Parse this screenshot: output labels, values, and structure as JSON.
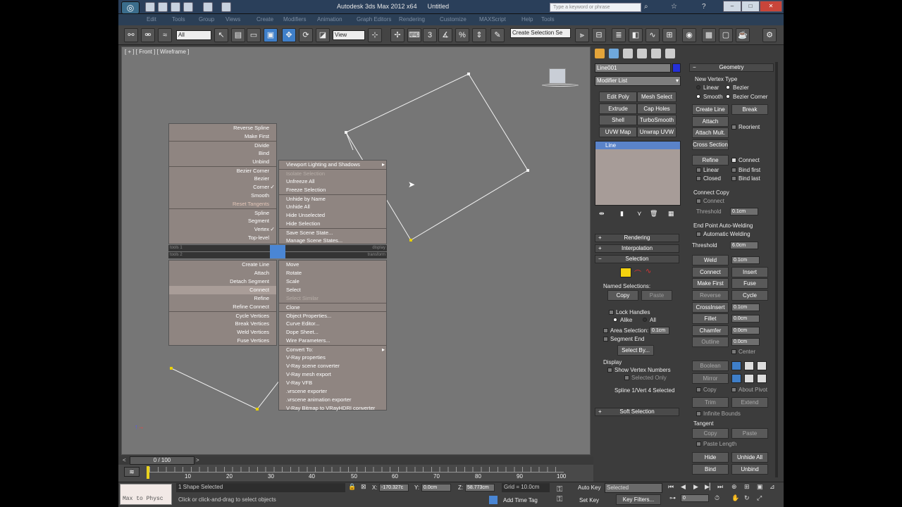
{
  "title": {
    "app": "Autodesk 3ds Max  2012 x64",
    "doc": "Untitled",
    "search_placeholder": "Type a keyword or phrase"
  },
  "menu": [
    "Edit",
    "Tools",
    "Group",
    "Views",
    "Create",
    "Modifiers",
    "Animation",
    "Graph Editors",
    "Rendering",
    "Customize",
    "MAXScript",
    "Help",
    "Tools"
  ],
  "toolbar": {
    "selection_filter": "All",
    "coord_system": "View",
    "named_set": "Create Selection Se",
    "snap_label": "3"
  },
  "viewport": {
    "label": "[ + ] [ Front ] [ Wireframe ]"
  },
  "quad": {
    "tl": [
      {
        "t": "Reverse Spline"
      },
      {
        "t": "Make First"
      },
      {
        "t": "Divide",
        "s": 1
      },
      {
        "t": "Bind"
      },
      {
        "t": "Unbind"
      },
      {
        "t": "Bezier Corner",
        "s": 1
      },
      {
        "t": "Bezier"
      },
      {
        "t": "Corner",
        "c": 1
      },
      {
        "t": "Smooth"
      },
      {
        "t": "Reset Tangents",
        "d": 1
      },
      {
        "t": "Spline",
        "s": 1
      },
      {
        "t": "Segment"
      },
      {
        "t": "Vertex",
        "c": 1
      },
      {
        "t": "Top-level"
      }
    ],
    "tr": [
      {
        "t": "Viewport Lighting and Shadows",
        "a": 1
      },
      {
        "t": "Isolate Selection",
        "s": 1,
        "g": 1
      },
      {
        "t": "Unfreeze All"
      },
      {
        "t": "Freeze Selection"
      },
      {
        "t": "Unhide by Name",
        "s": 1
      },
      {
        "t": "Unhide All"
      },
      {
        "t": "Hide Unselected"
      },
      {
        "t": "Hide Selection"
      },
      {
        "t": "Save Scene State...",
        "s": 1
      },
      {
        "t": "Manage Scene States..."
      }
    ],
    "bl": [
      {
        "t": "Create Line"
      },
      {
        "t": "Attach"
      },
      {
        "t": "Detach Segment"
      },
      {
        "t": "Connect",
        "h": 1
      },
      {
        "t": "Refine"
      },
      {
        "t": "Refine Connect"
      },
      {
        "t": "Cycle Vertices",
        "s": 1
      },
      {
        "t": "Break Vertices"
      },
      {
        "t": "Weld Vertices"
      },
      {
        "t": "Fuse Vertices"
      }
    ],
    "br": [
      {
        "t": "Move"
      },
      {
        "t": "Rotate"
      },
      {
        "t": "Scale"
      },
      {
        "t": "Select"
      },
      {
        "t": "Select Similar",
        "g": 1
      },
      {
        "t": "Clone",
        "s": 1
      },
      {
        "t": "Object Properties...",
        "s": 1
      },
      {
        "t": "Curve Editor..."
      },
      {
        "t": "Dope Sheet..."
      },
      {
        "t": "Wire Parameters..."
      },
      {
        "t": "Convert To:",
        "s": 1,
        "a": 1
      },
      {
        "t": "V-Ray properties"
      },
      {
        "t": "V-Ray scene converter"
      },
      {
        "t": "V-Ray mesh export"
      },
      {
        "t": "V-Ray VFB"
      },
      {
        "t": ".vrscene exporter"
      },
      {
        "t": ".vrscene animation exporter"
      },
      {
        "t": "V-Ray Bitmap to VRayHDRI converter"
      }
    ],
    "bar_left1": "tools 1",
    "bar_right1": "display",
    "bar_left2": "tools 2",
    "bar_right2": "transform"
  },
  "cmd": {
    "object_name": "Line001",
    "modifier_list": "Modifier List",
    "mod_buttons": [
      "Edit Poly",
      "Mesh Select",
      "Extrude",
      "Cap Holes",
      "Shell",
      "TurboSmooth",
      "UVW Map",
      "Unwrap UVW"
    ],
    "stack_item": "Line",
    "rollouts": {
      "rendering": "Rendering",
      "interpolation": "Interpolation",
      "selection": "Selection",
      "soft": "Soft Selection"
    },
    "selection": {
      "named": "Named Selections:",
      "copy": "Copy",
      "paste": "Paste",
      "lock": "Lock Handles",
      "alike": "Alike",
      "all": "All",
      "area": "Area Selection:",
      "area_val": "0.1cm",
      "seg_end": "Segment End",
      "select_by": "Select By...",
      "display": "Display",
      "show_vn": "Show Vertex Numbers",
      "sel_only": "Selected Only",
      "status": "Spline 1/Vert 4 Selected"
    }
  },
  "geom": {
    "title": "Geometry",
    "new_vertex": "New Vertex Type",
    "linear": "Linear",
    "bezier": "Bezier",
    "smooth": "Smooth",
    "bezier_corner": "Bezier Corner",
    "create_line": "Create Line",
    "break": "Break",
    "attach": "Attach",
    "attach_mult": "Attach Mult.",
    "reorient": "Reorient",
    "cross_section": "Cross Section",
    "refine": "Refine",
    "connect": "Connect",
    "linear2": "Linear",
    "bind_first": "Bind first",
    "closed": "Closed",
    "bind_last": "Bind last",
    "connect_copy": "Connect Copy",
    "connect2": "Connect",
    "threshold": "Threshold",
    "threshold_val": "0.1cm",
    "end_point": "End Point Auto-Welding",
    "auto_weld": "Automatic Welding",
    "threshold2_val": "6.0cm",
    "weld": "Weld",
    "weld_val": "0.1cm",
    "connect3": "Connect",
    "insert": "Insert",
    "make_first": "Make First",
    "fuse": "Fuse",
    "reverse": "Reverse",
    "cycle": "Cycle",
    "crossinsert": "CrossInsert",
    "cross_val": "0.1cm",
    "fillet": "Fillet",
    "fillet_val": "0.0cm",
    "chamfer": "Chamfer",
    "chamfer_val": "0.0cm",
    "outline": "Outline",
    "outline_val": "0.0cm",
    "center": "Center",
    "boolean": "Boolean",
    "mirror": "Mirror",
    "copy": "Copy",
    "about_pivot": "About Pivot",
    "trim": "Trim",
    "extend": "Extend",
    "infinite": "Infinite Bounds",
    "tangent": "Tangent",
    "tcopy": "Copy",
    "tpaste": "Paste",
    "paste_length": "Paste Length",
    "hide": "Hide",
    "unhide_all": "Unhide All",
    "bind": "Bind",
    "unbind": "Unbind"
  },
  "time": {
    "frame": "0 / 100",
    "ticks": [
      "10",
      "20",
      "30",
      "40",
      "50",
      "60",
      "70",
      "80",
      "90",
      "100"
    ]
  },
  "status": {
    "maxscript": "Max to Physc",
    "selected": "1 Shape Selected",
    "prompt": "Click or click-and-drag to select objects",
    "x_label": "X:",
    "x": "-170.327c",
    "y_label": "Y:",
    "y": "0.0cm",
    "z_label": "Z:",
    "z": "58.773cm",
    "grid": "Grid = 10.0cm",
    "add_time_tag": "Add Time Tag",
    "auto_key": "Auto Key",
    "set_key": "Set Key",
    "selected_drop": "Selected",
    "key_filters": "Key Filters...",
    "frame": "0"
  }
}
